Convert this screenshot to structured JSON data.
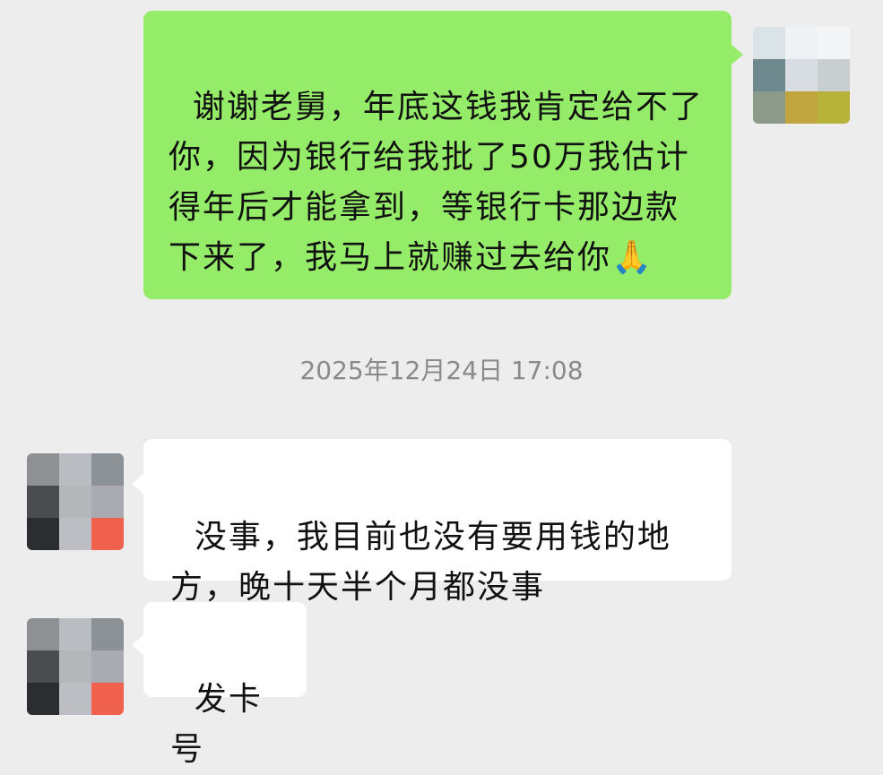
{
  "messages": [
    {
      "side": "sent",
      "text": "谢谢老舅，年底这钱我肯定给不了你，因为银行给我批了50万我估计得年后才能拿到，等银行卡那边款下来了，我马上就赚过去给你🙏"
    },
    {
      "side": "received",
      "text": "没事，我目前也没有要用钱的地方，晚十天半个月都没事"
    },
    {
      "side": "received",
      "text": "发卡号"
    }
  ],
  "timestamp": "2025年12月24日 17:08",
  "colors": {
    "background": "#ededed",
    "sent_bubble": "#95ec69",
    "received_bubble": "#ffffff",
    "timestamp_text": "#8a8a8a"
  }
}
